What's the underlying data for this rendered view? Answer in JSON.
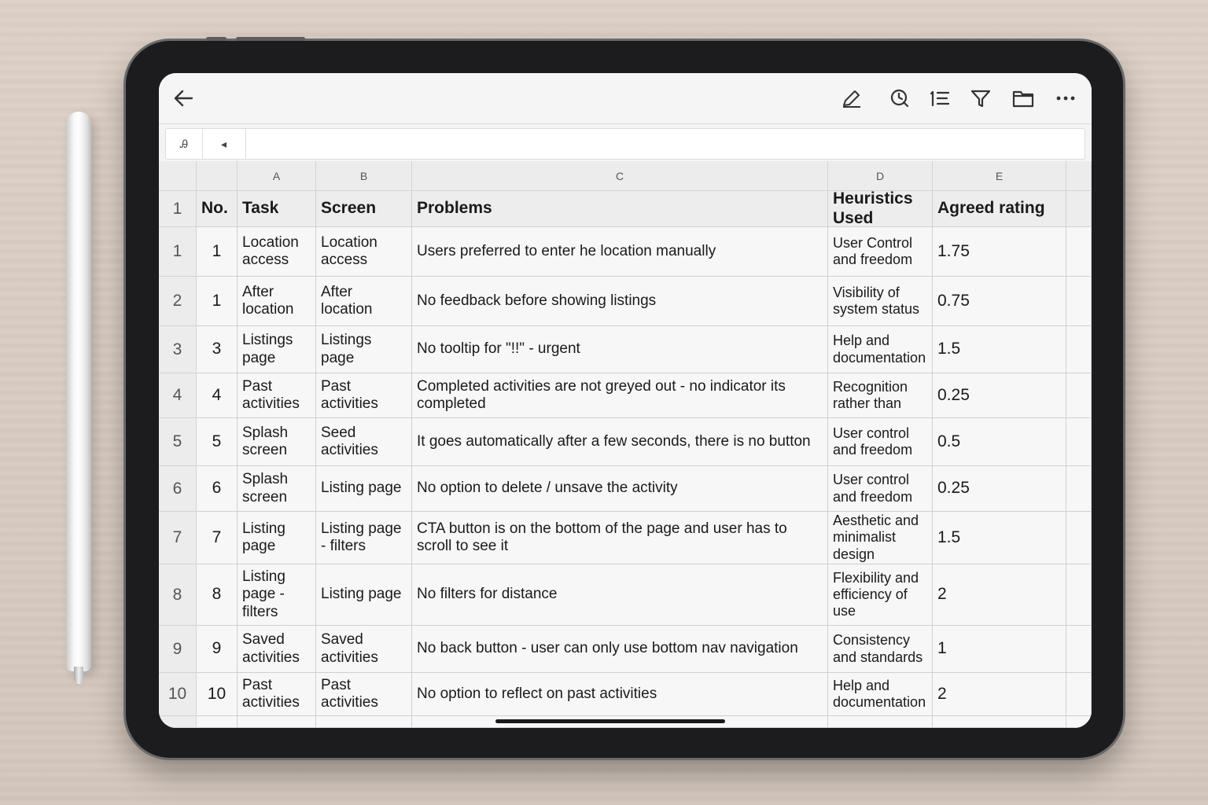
{
  "toolbar": {
    "icons": [
      "back-arrow-icon",
      "pencil-icon",
      "search-history-icon",
      "list-number-icon",
      "filter-icon",
      "folder-icon",
      "more-icon"
    ]
  },
  "formula_bar": {
    "cell_ref": "Ꭿ",
    "arrow": "◂"
  },
  "columns": [
    "A",
    "B",
    "C",
    "D",
    "E"
  ],
  "header_row": {
    "row_label": "1",
    "no": "No.",
    "task": "Task",
    "screen": "Screen",
    "problems": "Problems",
    "heuristics": "Heuristics Used",
    "rating": "Agreed rating"
  },
  "rows": [
    {
      "row": "1",
      "no": "1",
      "task": "Location access",
      "screen": "Location access",
      "problem": "Users preferred to enter he location manually",
      "heuristic": "User Control and freedom",
      "rating": "1.75"
    },
    {
      "row": "2",
      "no": "1",
      "task": "After location",
      "screen": "After location",
      "problem": "No feedback before showing listings",
      "heuristic": "Visibility of system status",
      "rating": "0.75"
    },
    {
      "row": "3",
      "no": "3",
      "task": "Listings page",
      "screen": "Listings page",
      "problem": "No tooltip for \"!!\" - urgent",
      "heuristic": "Help and documentation",
      "rating": "1.5"
    },
    {
      "row": "4",
      "no": "4",
      "task": "Past activities",
      "screen": "Past activities",
      "problem": "Completed activities are not greyed out - no indicator its completed",
      "heuristic": "Recognition rather than",
      "rating": "0.25"
    },
    {
      "row": "5",
      "no": "5",
      "task": "Splash screen",
      "screen": "Seed activities",
      "problem": "It goes automatically after a few seconds, there is no button",
      "heuristic": "User control and freedom",
      "rating": "0.5"
    },
    {
      "row": "6",
      "no": "6",
      "task": "Splash screen",
      "screen": "Listing page",
      "problem": "No option to delete / unsave the activity",
      "heuristic": "User control and freedom",
      "rating": "0.25"
    },
    {
      "row": "7",
      "no": "7",
      "task": "Listing page",
      "screen": "Listing page - filters",
      "problem": "CTA button is on the bottom of the page and user has to scroll to see it",
      "heuristic": "Aesthetic and minimalist design",
      "rating": "1.5"
    },
    {
      "row": "8",
      "no": "8",
      "task": "Listing page - filters",
      "screen": "Listing page",
      "problem": "No filters for distance",
      "heuristic": "Flexibility and efficiency of use",
      "rating": "2"
    },
    {
      "row": "9",
      "no": "9",
      "task": "Saved activities",
      "screen": "Saved activities",
      "problem": "No back button - user can only use bottom nav navigation",
      "heuristic": "Consistency and standards",
      "rating": "1"
    },
    {
      "row": "10",
      "no": "10",
      "task": "Past activities",
      "screen": "Past activities",
      "problem": "No option to reflect on past activities",
      "heuristic": "Help and documentation",
      "rating": "2"
    }
  ]
}
